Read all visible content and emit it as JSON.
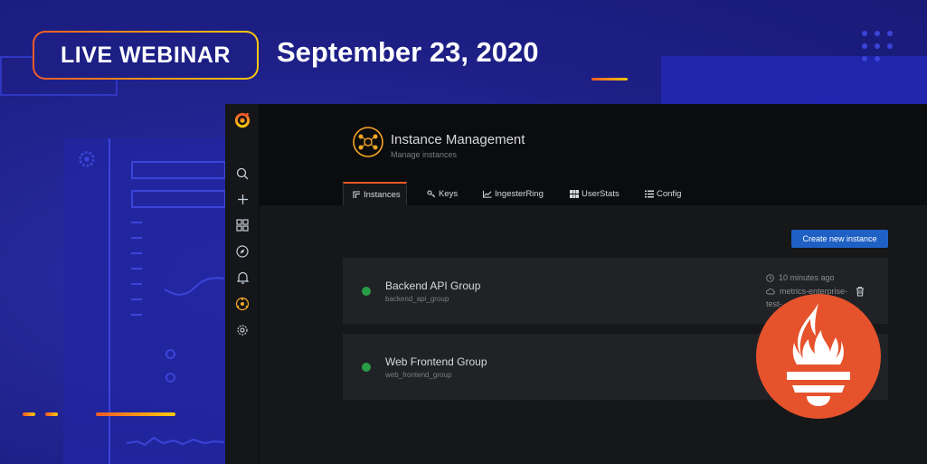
{
  "banner": {
    "badge": "LIVE WEBINAR",
    "date": "September 23, 2020",
    "colors": {
      "background": "#1d1f85",
      "accent_start": "#f05a28",
      "accent_end": "#fbca0a"
    }
  },
  "sidemenu": {
    "items": [
      {
        "icon": "grafana-logo-icon"
      },
      {
        "icon": "search-icon"
      },
      {
        "icon": "plus-icon"
      },
      {
        "icon": "dashboards-icon"
      },
      {
        "icon": "explore-compass-icon"
      },
      {
        "icon": "bell-alerting-icon"
      },
      {
        "icon": "plugin-enterprise-icon"
      },
      {
        "icon": "gear-icon"
      }
    ]
  },
  "header": {
    "title": "Instance Management",
    "subtitle": "Manage instances"
  },
  "tabs": [
    {
      "label": "Instances",
      "icon": "instances-icon",
      "active": true
    },
    {
      "label": "Keys",
      "icon": "key-icon",
      "active": false
    },
    {
      "label": "IngesterRing",
      "icon": "graph-icon",
      "active": false
    },
    {
      "label": "UserStats",
      "icon": "grid-icon",
      "active": false
    },
    {
      "label": "Config",
      "icon": "list-icon",
      "active": false
    }
  ],
  "create_button": "Create new instance",
  "instances": [
    {
      "name": "Backend API Group",
      "slug": "backend_api_group",
      "status_color": "#299c46",
      "updated": "10 minutes ago",
      "cluster": "metrics-enterprise-",
      "cluster_overflow": "test-"
    },
    {
      "name": "Web Frontend Group",
      "slug": "web_frontend_group",
      "status_color": "#299c46"
    }
  ],
  "overlay_logo": {
    "icon": "prometheus-logo-icon",
    "color": "#e6522c"
  }
}
